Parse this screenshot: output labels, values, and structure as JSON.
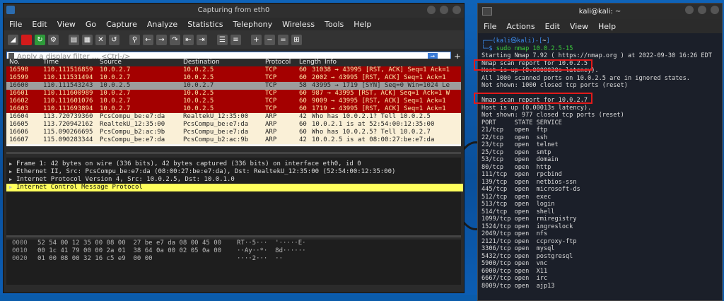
{
  "wireshark": {
    "title": "Capturing from eth0",
    "menu": [
      "File",
      "Edit",
      "View",
      "Go",
      "Capture",
      "Analyze",
      "Statistics",
      "Telephony",
      "Wireless",
      "Tools",
      "Help"
    ],
    "filter_placeholder": "Apply a display filter … <Ctrl-/>",
    "columns": [
      "No.",
      "Time",
      "Source",
      "Destination",
      "Protocol",
      "Length",
      "Info"
    ],
    "packets": [
      {
        "no": "16598",
        "time": "110.111516859",
        "src": "10.0.2.7",
        "dst": "10.0.2.5",
        "proto": "TCP",
        "len": "60",
        "info": "31038 → 43995 [RST, ACK] Seq=1 Ack=1",
        "kind": "tcp"
      },
      {
        "no": "16599",
        "time": "110.111531494",
        "src": "10.0.2.7",
        "dst": "10.0.2.5",
        "proto": "TCP",
        "len": "60",
        "info": "2002 → 43995 [RST, ACK] Seq=1 Ack=1",
        "kind": "tcp"
      },
      {
        "no": "16600",
        "time": "110.111543243",
        "src": "10.0.2.5",
        "dst": "10.0.2.7",
        "proto": "TCP",
        "len": "58",
        "info": "43995 → 1719 [SYN] Seq=0 Win=1024 Le",
        "kind": "sel"
      },
      {
        "no": "16601",
        "time": "110.111600989",
        "src": "10.0.2.7",
        "dst": "10.0.2.5",
        "proto": "TCP",
        "len": "60",
        "info": "987 → 43995 [RST, ACK] Seq=1 Ack=1 W",
        "kind": "tcp"
      },
      {
        "no": "16602",
        "time": "110.111601076",
        "src": "10.0.2.7",
        "dst": "10.0.2.5",
        "proto": "TCP",
        "len": "60",
        "info": "9009 → 43995 [RST, ACK] Seq=1 Ack=1",
        "kind": "tcp"
      },
      {
        "no": "16603",
        "time": "110.111693894",
        "src": "10.0.2.7",
        "dst": "10.0.2.5",
        "proto": "TCP",
        "len": "60",
        "info": "1719 → 43995 [RST, ACK] Seq=1 Ack=1",
        "kind": "tcp"
      },
      {
        "no": "16604",
        "time": "113.720739360",
        "src": "PcsCompu_be:e7:da",
        "dst": "RealtekU_12:35:00",
        "proto": "ARP",
        "len": "42",
        "info": "Who has 10.0.2.1? Tell 10.0.2.5",
        "kind": "arp"
      },
      {
        "no": "16605",
        "time": "113.720942162",
        "src": "RealtekU_12:35:00",
        "dst": "PcsCompu_be:e7:da",
        "proto": "ARP",
        "len": "60",
        "info": "10.0.2.1 is at 52:54:00:12:35:00",
        "kind": "arp"
      },
      {
        "no": "16606",
        "time": "115.090266695",
        "src": "PcsCompu_b2:ac:9b",
        "dst": "PcsCompu_be:e7:da",
        "proto": "ARP",
        "len": "60",
        "info": "Who has 10.0.2.5? Tell 10.0.2.7",
        "kind": "arp"
      },
      {
        "no": "16607",
        "time": "115.090283344",
        "src": "PcsCompu_be:e7:da",
        "dst": "PcsCompu_b2:ac:9b",
        "proto": "ARP",
        "len": "42",
        "info": "10.0.2.5 is at 08:00:27:be:e7:da",
        "kind": "arp"
      }
    ],
    "details": [
      "Frame 1: 42 bytes on wire (336 bits), 42 bytes captured (336 bits) on interface eth0, id 0",
      "Ethernet II, Src: PcsCompu_be:e7:da (08:00:27:be:e7:da), Dst: RealtekU_12:35:00 (52:54:00:12:35:00)",
      "Internet Protocol Version 4, Src: 10.0.2.5, Dst: 10.0.1.0",
      "Internet Control Message Protocol"
    ],
    "hex": [
      {
        "off": "0000",
        "bytes": "52 54 00 12 35 00 08 00  27 be e7 da 08 00 45 00",
        "ascii": "RT··5···  '·····E·"
      },
      {
        "off": "0010",
        "bytes": "00 1c 41 79 00 00 2a 01  38 64 0a 00 02 05 0a 00",
        "ascii": "··Ay··*·  8d······"
      },
      {
        "off": "0020",
        "bytes": "01 00 08 00 32 16 c5 e9  00 00",
        "ascii": "····2···  ··"
      }
    ]
  },
  "terminal": {
    "title": "kali@kali: ~",
    "menu": [
      "File",
      "Actions",
      "Edit",
      "View",
      "Help"
    ],
    "prompt_user": "kali",
    "prompt_host": "kali",
    "prompt_dir": "~",
    "command": "sudo nmap 10.0.2.5-15",
    "output": [
      "Starting Nmap 7.92 ( https://nmap.org ) at 2022-09-30 16:26 EDT",
      "Nmap scan report for 10.0.2.5",
      "Host is up (0.0000030s latency).",
      "All 1000 scanned ports on 10.0.2.5 are in ignored states.",
      "Not shown: 1000 closed tcp ports (reset)",
      "",
      "Nmap scan report for 10.0.2.7",
      "Host is up (0.00013s latency).",
      "Not shown: 977 closed tcp ports (reset)",
      "PORT     STATE SERVICE",
      "21/tcp   open  ftp",
      "22/tcp   open  ssh",
      "23/tcp   open  telnet",
      "25/tcp   open  smtp",
      "53/tcp   open  domain",
      "80/tcp   open  http",
      "111/tcp  open  rpcbind",
      "139/tcp  open  netbios-ssn",
      "445/tcp  open  microsoft-ds",
      "512/tcp  open  exec",
      "513/tcp  open  login",
      "514/tcp  open  shell",
      "1099/tcp open  rmiregistry",
      "1524/tcp open  ingreslock",
      "2049/tcp open  nfs",
      "2121/tcp open  ccproxy-ftp",
      "3306/tcp open  mysql",
      "5432/tcp open  postgresql",
      "5900/tcp open  vnc",
      "6000/tcp open  X11",
      "6667/tcp open  irc",
      "8009/tcp open  ajp13"
    ]
  },
  "colors": {
    "tcp_row": "#a40000",
    "arp_row": "#faf0d7",
    "selected_row": "#9d9d9d",
    "highlight": "#ffff5c",
    "red_box": "#e21a1a"
  }
}
